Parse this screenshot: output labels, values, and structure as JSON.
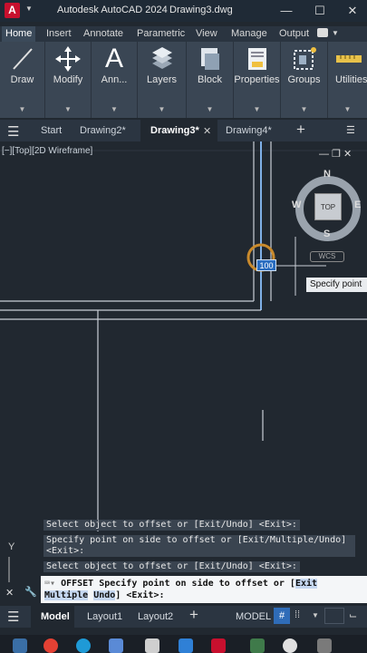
{
  "titlebar": {
    "app_name": "Autodesk AutoCAD 2024",
    "doc_name": "Drawing3.dwg",
    "logo": "A"
  },
  "ribbon_tabs": [
    "Home",
    "Insert",
    "Annotate",
    "Parametric",
    "View",
    "Manage",
    "Output"
  ],
  "ribbon_panels": [
    {
      "label": "Draw",
      "icon": "line-icon"
    },
    {
      "label": "Modify",
      "icon": "move-icon"
    },
    {
      "label": "Ann...",
      "icon": "text-a-icon"
    },
    {
      "label": "Layers",
      "icon": "layers-icon"
    },
    {
      "label": "Block",
      "icon": "block-icon"
    },
    {
      "label": "Properties",
      "icon": "properties-icon"
    },
    {
      "label": "Groups",
      "icon": "groups-icon"
    },
    {
      "label": "Utilities",
      "icon": "ruler-icon"
    }
  ],
  "doc_tabs": {
    "start": "Start",
    "tab1": "Drawing2*",
    "tab2": "Drawing3*",
    "tab3": "Drawing4*"
  },
  "viewport": {
    "label": "[−][Top][2D Wireframe]",
    "compass": {
      "n": "N",
      "s": "S",
      "e": "E",
      "w": "W",
      "top": "TOP",
      "ucs": "WCS"
    },
    "dynamic_input_value": "100",
    "tooltip": "Specify point"
  },
  "command_history": [
    "Select object to offset or [Exit/Undo] <Exit>:",
    "Specify point on side to offset or [Exit/Multiple/Undo]",
    "<Exit>:",
    "Select object to offset or [Exit/Undo] <Exit>:"
  ],
  "command_input": {
    "prefix": "OFFSET Specify point on side to offset or [",
    "opt_exit": "Exit",
    "opt_multiple": "Multiple",
    "opt_undo": "Undo",
    "suffix": "] <Exit>:"
  },
  "status_tabs": {
    "model": "Model",
    "layout1": "Layout1",
    "layout2": "Layout2"
  },
  "status_model_button": "MODEL"
}
